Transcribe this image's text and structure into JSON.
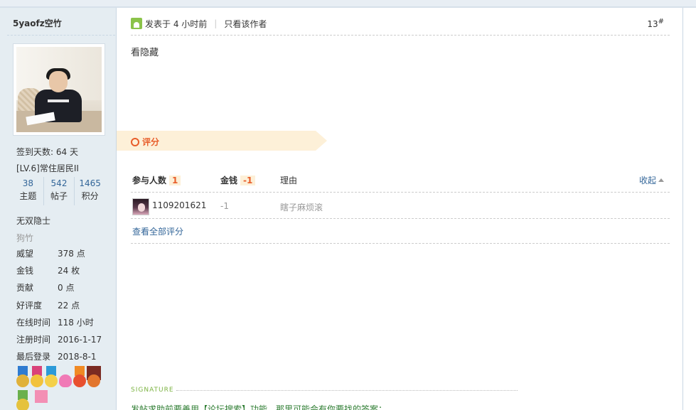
{
  "user": {
    "name": "5yaofz空竹",
    "checkin": "签到天数: 64 天",
    "level": "[LV.6]常住居民II",
    "counts": [
      {
        "value": "38",
        "label": "主题"
      },
      {
        "value": "542",
        "label": "帖子"
      },
      {
        "value": "1465",
        "label": "积分"
      }
    ],
    "rank": "无双隐士",
    "custom_title": "狗竹",
    "stats": [
      {
        "key": "威望",
        "value": "378 点"
      },
      {
        "key": "金钱",
        "value": "24 枚"
      },
      {
        "key": "贡献",
        "value": "0 点"
      },
      {
        "key": "好评度",
        "value": "22 点"
      },
      {
        "key": "在线时间",
        "value": "118 小时"
      },
      {
        "key": "注册时间",
        "value": "2016-1-17"
      },
      {
        "key": "最后登录",
        "value": "2018-8-1"
      }
    ]
  },
  "post": {
    "posted": "发表于 4 小时前",
    "author_only": "只看该作者",
    "floor": "13",
    "floor_mark": "#",
    "content": "看隐藏"
  },
  "rating": {
    "title": "评分",
    "participants_label": "参与人数",
    "participants_count": "1",
    "money_label": "金钱",
    "money_total": "-1",
    "reason_label": "理由",
    "collapse_label": "收起",
    "rows": [
      {
        "user": "1109201621",
        "money": "-1",
        "reason": "瞎子麻烦滚"
      }
    ],
    "view_all": "查看全部评分"
  },
  "signature": {
    "label": "SIGNATURE",
    "text": "发帖求助前要善用【论坛搜索】功能，那里可能会有你要找的答案；"
  },
  "colors": {
    "accent": "#e85d2a",
    "link": "#336699",
    "sidebar_bg": "#e5edf2",
    "signature": "#2e7d32"
  }
}
